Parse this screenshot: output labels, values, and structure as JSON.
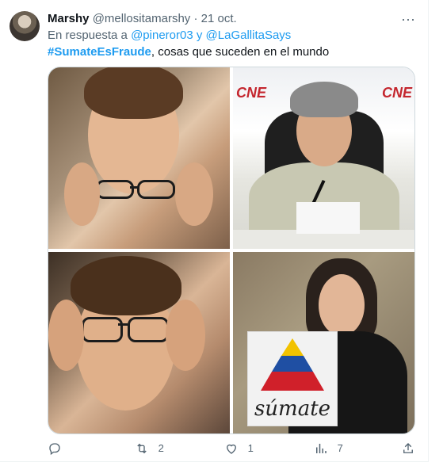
{
  "tweet": {
    "author_name": "Marshy",
    "handle": "@mellositamarshy",
    "separator": "·",
    "date": "21 oct.",
    "reply_prefix": "En respuesta a",
    "reply_to_1": "@pineror03",
    "reply_joiner": "y",
    "reply_to_2": "@LaGallitaSays",
    "hashtag": "#SumateEsFraude",
    "body": ", cosas que suceden en el mundo"
  },
  "media": {
    "panels": [
      {
        "subject": "man holding glasses"
      },
      {
        "subject": "woman at press conference with CNE logos",
        "logo_text": "CNE"
      },
      {
        "subject": "man wearing glasses"
      },
      {
        "subject": "woman holding sumate sign",
        "sign_text": "súmate"
      }
    ]
  },
  "actions": {
    "reply": {
      "icon": "reply-icon",
      "count": ""
    },
    "retweet": {
      "icon": "retweet-icon",
      "count": "2"
    },
    "like": {
      "icon": "heart-icon",
      "count": "1"
    },
    "views": {
      "icon": "views-icon",
      "count": "7"
    },
    "share": {
      "icon": "share-icon",
      "count": ""
    }
  },
  "colors": {
    "accent": "#1d9bf0",
    "secondary_text": "#536471",
    "border": "#cfd9de"
  }
}
